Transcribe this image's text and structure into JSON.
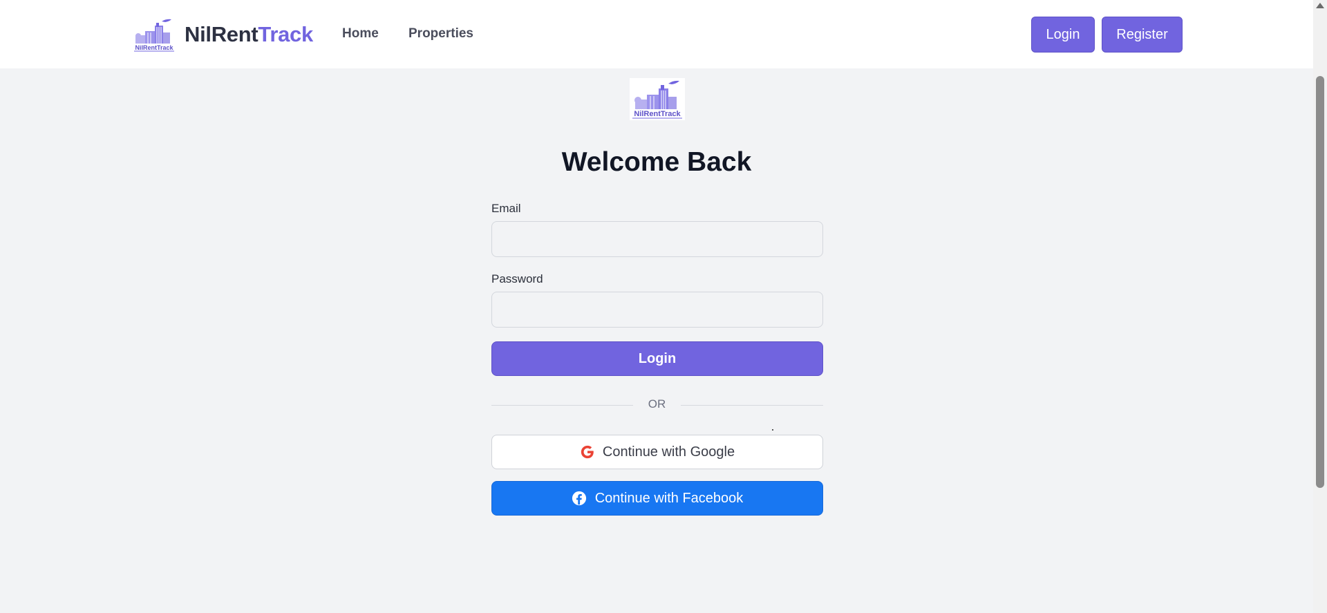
{
  "header": {
    "brand_part1": "NilRent",
    "brand_part2": "Track",
    "logo_text": "NilRentTrack",
    "nav": {
      "home": "Home",
      "properties": "Properties"
    },
    "login_label": "Login",
    "register_label": "Register"
  },
  "login_form": {
    "logo_text": "NilRentTrack",
    "title": "Welcome Back",
    "email_label": "Email",
    "email_value": "",
    "password_label": "Password",
    "password_value": "",
    "submit_label": "Login",
    "divider_text": "OR",
    "google_label": "Continue with Google",
    "facebook_label": "Continue with Facebook"
  },
  "colors": {
    "accent": "#7164df",
    "facebook": "#1877f2",
    "google_red": "#ea4335",
    "page_bg": "#f2f3f5"
  },
  "icons": {
    "brand_logo": "building-logo-icon",
    "google": "google-g-icon",
    "facebook": "facebook-f-icon"
  }
}
